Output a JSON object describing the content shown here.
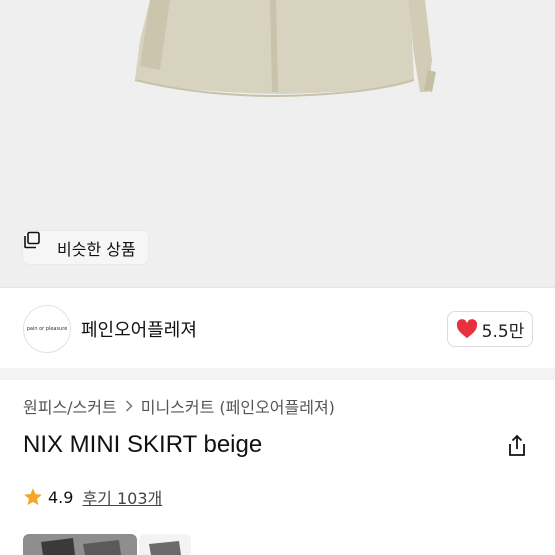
{
  "hero": {
    "similar_label": "비슷한 상품",
    "similar_icon": "copy-icon"
  },
  "shop": {
    "logo_text": "pain or pleasure",
    "name": "페인오어플레져",
    "like_count": "5.5만",
    "like_icon": "heart-icon",
    "like_color": "#e8313f"
  },
  "breadcrumb": {
    "category": "원피스/스커트",
    "subcategory": "미니스커트 (페인오어플레져)"
  },
  "product": {
    "title": "NIX MINI SKIRT beige",
    "rating": "4.9",
    "reviews": "후기 103개",
    "star_color": "#f5a623"
  }
}
